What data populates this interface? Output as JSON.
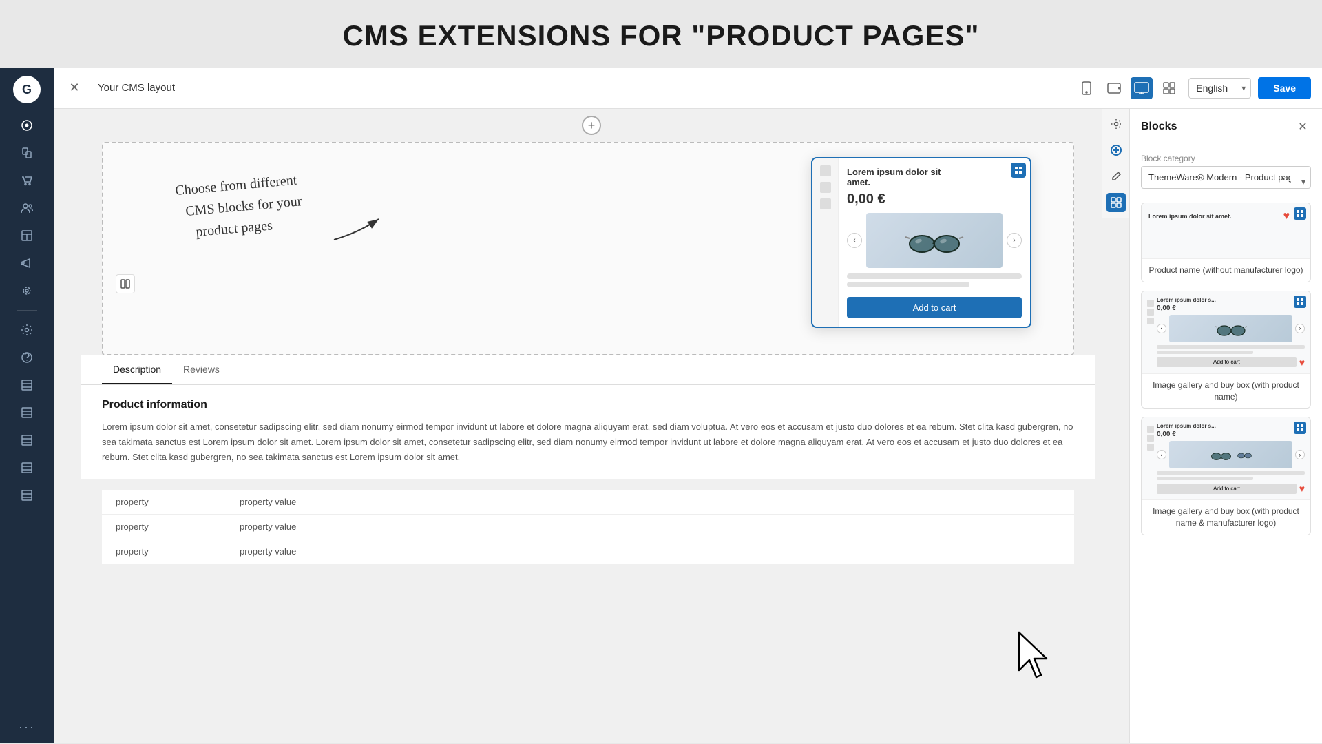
{
  "page": {
    "title": "CMS EXTENSIONS FOR \"PRODUCT PAGES\""
  },
  "topbar": {
    "title": "Your CMS layout",
    "save_label": "Save",
    "language": "English"
  },
  "devices": [
    {
      "id": "mobile",
      "icon": "📱"
    },
    {
      "id": "tablet-portrait",
      "icon": "⬜"
    },
    {
      "id": "tablet-landscape",
      "icon": "🖥",
      "active": true
    },
    {
      "id": "desktop-grid",
      "icon": "▦"
    }
  ],
  "sidebar": {
    "items": [
      {
        "id": "dashboard",
        "icon": "⊙"
      },
      {
        "id": "pages",
        "icon": "⧉"
      },
      {
        "id": "shopping-bag",
        "icon": "🛍"
      },
      {
        "id": "users",
        "icon": "👥"
      },
      {
        "id": "layouts",
        "icon": "⊟"
      },
      {
        "id": "marketing",
        "icon": "📣"
      },
      {
        "id": "integrations",
        "icon": "⟳"
      },
      {
        "id": "settings",
        "icon": "⚙"
      },
      {
        "id": "help-circle",
        "icon": "⊕"
      },
      {
        "id": "table1",
        "icon": "⊞"
      },
      {
        "id": "table2",
        "icon": "⊞"
      },
      {
        "id": "table3",
        "icon": "⊞"
      },
      {
        "id": "table4",
        "icon": "⊞"
      },
      {
        "id": "table5",
        "icon": "⊞"
      }
    ]
  },
  "canvas": {
    "add_button": "+",
    "annotation_text": "Choose from different\nCMS blocks for your\nproduct pages"
  },
  "product_card": {
    "title": "Lorem ipsum dolor sit amet.",
    "price": "0,00 €",
    "add_to_cart": "Add to cart"
  },
  "tabs": [
    {
      "id": "description",
      "label": "Description",
      "active": true
    },
    {
      "id": "reviews",
      "label": "Reviews",
      "active": false
    }
  ],
  "product_info": {
    "section_title": "Product information",
    "description": "Lorem ipsum dolor sit amet, consetetur sadipscing elitr, sed diam nonumy eirmod tempor invidunt ut labore et dolore magna aliquyam erat, sed diam voluptua. At vero eos et accusam et justo duo dolores et ea rebum. Stet clita kasd gubergren, no sea takimata sanctus est Lorem ipsum dolor sit amet. Lorem ipsum dolor sit amet, consetetur sadipscing elitr, sed diam nonumy eirmod tempor invidunt ut labore et dolore magna aliquyam erat. At vero eos et accusam et justo duo dolores et ea rebum. Stet clita kasd gubergren, no sea takimata sanctus est Lorem ipsum dolor sit amet."
  },
  "properties": [
    {
      "key": "property",
      "value": "property value"
    },
    {
      "key": "property",
      "value": "property value"
    },
    {
      "key": "property",
      "value": "property value"
    }
  ],
  "right_panel": {
    "title": "Blocks",
    "block_category_label": "Block category",
    "block_category_value": "ThemeWare® Modern - Product page",
    "blocks": [
      {
        "id": "product-name",
        "preview_type": "product-name",
        "label": "Product name (without manufacturer logo)"
      },
      {
        "id": "image-gallery-buy-box",
        "preview_type": "image-gallery",
        "label": "Image gallery and buy box (with product name)"
      },
      {
        "id": "image-gallery-buy-box-logo",
        "preview_type": "image-gallery-logo",
        "label": "Image gallery and buy box (with product name & manufacturer logo)"
      }
    ]
  }
}
